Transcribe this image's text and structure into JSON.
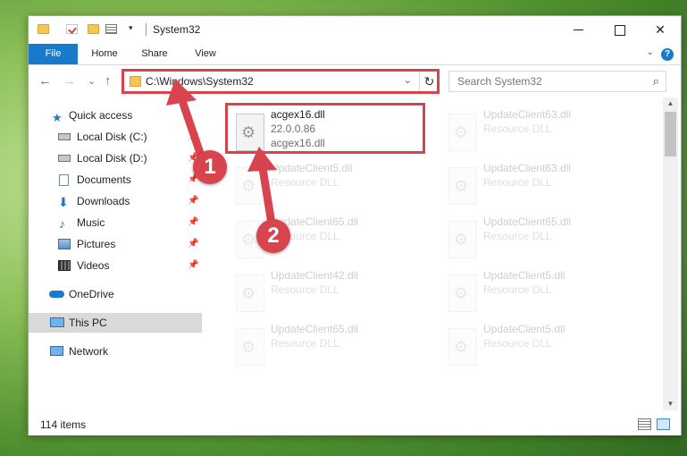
{
  "window": {
    "title": "System32",
    "quick_access_dropdown": "▾",
    "controls": {
      "minimize": "",
      "maximize": "",
      "close": "✕"
    }
  },
  "ribbon": {
    "tabs": [
      "File",
      "Home",
      "Share",
      "View"
    ],
    "collapse": "⌄",
    "help": "?"
  },
  "nav": {
    "back": "←",
    "forward": "→",
    "recent": "⌄",
    "up": "↑",
    "address": "C:\\Windows\\System32",
    "address_dropdown": "⌄",
    "refresh": "↻",
    "search_placeholder": "Search System32",
    "search_icon": "⌕"
  },
  "sidebar": {
    "items": [
      {
        "label": "Quick access",
        "icon": "star-icon"
      },
      {
        "label": "Local Disk (C:)",
        "icon": "drive-icon",
        "pinned": true
      },
      {
        "label": "Local Disk (D:)",
        "icon": "drive-icon",
        "pinned": true
      },
      {
        "label": "Documents",
        "icon": "documents-icon",
        "pinned": true
      },
      {
        "label": "Downloads",
        "icon": "download-icon",
        "pinned": true
      },
      {
        "label": "Music",
        "icon": "music-icon",
        "pinned": true
      },
      {
        "label": "Pictures",
        "icon": "pictures-icon",
        "pinned": true
      },
      {
        "label": "Videos",
        "icon": "videos-icon",
        "pinned": true
      },
      {
        "label": "OneDrive",
        "icon": "cloud-icon"
      },
      {
        "label": "This PC",
        "icon": "computer-icon"
      },
      {
        "label": "Network",
        "icon": "network-icon"
      }
    ],
    "pin_glyph": "📌"
  },
  "files": [
    {
      "name": "acgex16.dll",
      "line2": "22.0.0.86",
      "line3": "acgex16.dll"
    },
    {
      "name": "UpdateClient63.dll",
      "line2": "Resource DLL"
    },
    {
      "name": "UpdateClient5.dll",
      "line2": "Resource DLL"
    },
    {
      "name": "UpdateClient63.dll",
      "line2": "Resource DLL"
    },
    {
      "name": "UpdateClient65.dll",
      "line2": "Resource DLL"
    },
    {
      "name": "UpdateClient65.dll",
      "line2": "Resource DLL"
    },
    {
      "name": "UpdateClient42.dll",
      "line2": "Resource DLL"
    },
    {
      "name": "UpdateClient5.dll",
      "line2": "Resource DLL"
    },
    {
      "name": "UpdateClient65.dll",
      "line2": "Resource DLL"
    },
    {
      "name": "UpdateClient5.dll",
      "line2": "Resource DLL"
    }
  ],
  "status": {
    "item_count": "114 items"
  },
  "callouts": {
    "step1": "1",
    "step2": "2"
  },
  "colors": {
    "accent": "#1979ca",
    "callout": "#d8444e",
    "selection": "#cce8ff"
  }
}
